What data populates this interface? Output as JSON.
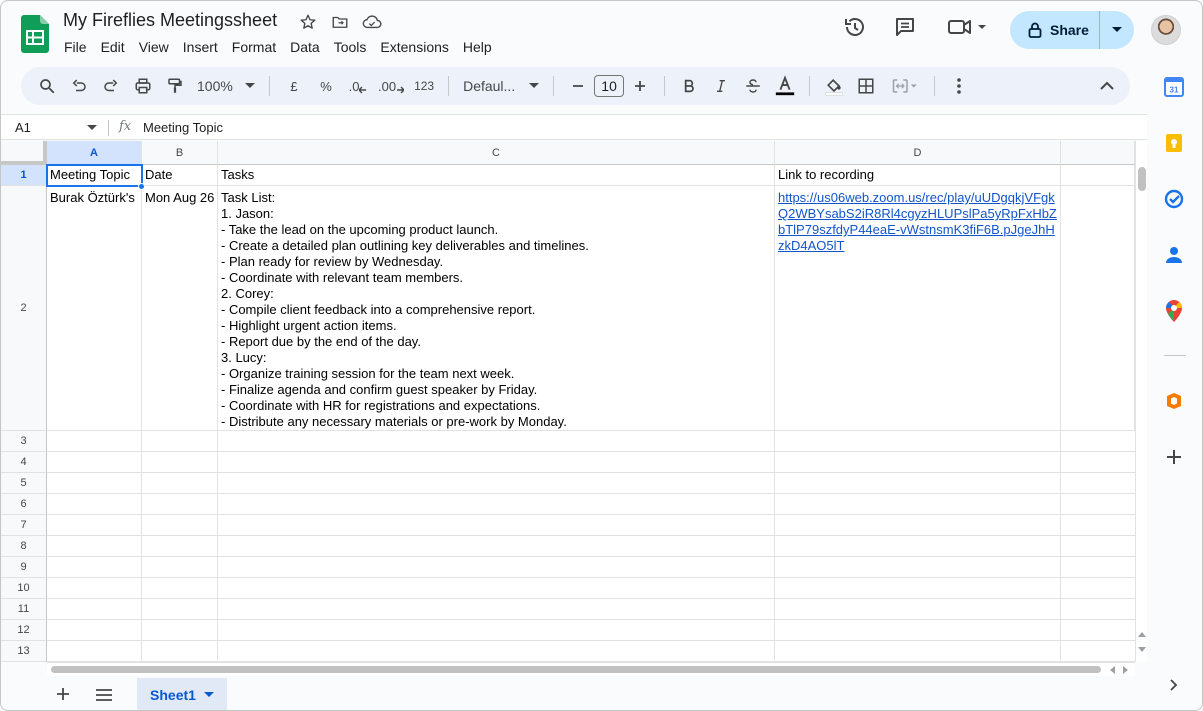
{
  "title": "My Fireflies Meetingssheet",
  "menu": [
    "File",
    "Edit",
    "View",
    "Insert",
    "Format",
    "Data",
    "Tools",
    "Extensions",
    "Help"
  ],
  "share_label": "Share",
  "toolbar": {
    "zoom": "100%",
    "currency": "£",
    "percent": "%",
    "decrease_decimal": ".0",
    "increase_decimal": ".00",
    "format_123": "123",
    "font": "Defaul...",
    "font_size": "10"
  },
  "formula_bar": {
    "cell_ref": "A1",
    "fx": "fx",
    "content": "Meeting Topic"
  },
  "columns": [
    "A",
    "B",
    "C",
    "D"
  ],
  "rows": [
    "1",
    "2",
    "3",
    "4",
    "5",
    "6",
    "7",
    "8",
    "9",
    "10",
    "11",
    "12",
    "13"
  ],
  "cells": {
    "A1": "Meeting Topic",
    "B1": "Date",
    "C1": "Tasks",
    "D1": "Link to recording",
    "A2": "Burak Öztürk's",
    "B2": "Mon Aug 26",
    "C2": "Task List:\n1. Jason:\n- Take the lead on the upcoming product launch.\n- Create a detailed plan outlining key deliverables and timelines.\n- Plan ready for review by Wednesday.\n- Coordinate with relevant team members.\n2. Corey:\n- Compile client feedback into a comprehensive report.\n- Highlight urgent action items.\n- Report due by the end of the day.\n3. Lucy:\n- Organize training session for the team next week.\n- Finalize agenda and confirm guest speaker by Friday.\n- Coordinate with HR for registrations and expectations.\n- Distribute any necessary materials or pre-work by Monday.",
    "D2": "https://us06web.zoom.us/rec/play/uUDgqkjVFgkQ2WBYsabS2iR8Rl4cgyzHLUPslPa5yRpFxHbZbTlP79szfdyP44eaE-vWstnsmK3fiF6B.pJgeJhHzkD4AO5lT"
  },
  "sheet_tab": "Sheet1",
  "colors": {
    "accent": "#1a73e8",
    "share_bg": "#c2e7ff",
    "link": "#1155cc"
  },
  "side_icons": [
    "calendar-icon",
    "keep-icon",
    "tasks-icon",
    "contacts-icon",
    "maps-icon",
    "office-icon",
    "add-icon"
  ]
}
